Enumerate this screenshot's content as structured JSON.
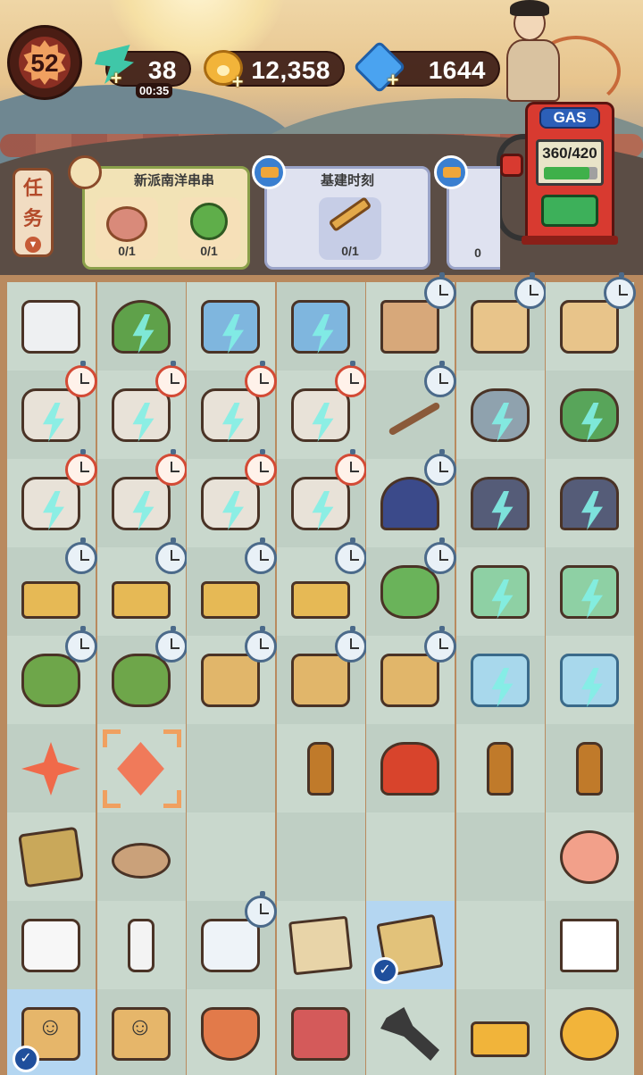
{
  "hud": {
    "level": "52",
    "energy": "38",
    "energy_timer": "00:35",
    "coins": "12,358",
    "gems": "1644",
    "plus": "+"
  },
  "gas_pump": {
    "label": "GAS",
    "amount": "360/420",
    "fill_fraction": 0.857
  },
  "tasks": {
    "tab_label_1": "任",
    "tab_label_2": "务",
    "cards": [
      {
        "title": "新派南洋串串",
        "slots": [
          {
            "icon": "meat-patty-icon",
            "count": "0/1"
          },
          {
            "icon": "broccoli-icon",
            "count": "0/1"
          }
        ]
      },
      {
        "title": "基建时刻",
        "slots": [
          {
            "icon": "hammer-icon",
            "count": "0/1"
          }
        ]
      },
      {
        "title": "",
        "slots": [
          {
            "icon": "partial-item-icon",
            "count": "0"
          }
        ]
      }
    ]
  },
  "board": {
    "rows": [
      [
        "printer",
        "tree-bolt",
        "book-bolt",
        "book-bolt",
        "shelf-timer",
        "cabinet-timer",
        "cabinet-timer"
      ],
      [
        "logs-bolt-redtimer",
        "logs-bolt-redtimer",
        "logs-bolt-redtimer",
        "logs-bolt-redtimer",
        "feather-timer",
        "drum-bolt",
        "drum-green-bolt"
      ],
      [
        "logs-bolt-redtimer",
        "logs-bolt-redtimer",
        "logs-bolt-redtimer",
        "logs-bolt-redtimer",
        "hat-timer",
        "chef-bolt",
        "chef-bolt"
      ],
      [
        "drone-timer",
        "drone-timer",
        "drone-timer",
        "drone-timer",
        "scooter-timer",
        "cart-bolt",
        "cart-bolt"
      ],
      [
        "bike-timer",
        "bike-timer",
        "dolly-timer",
        "dolly-timer",
        "dolly-timer",
        "cooler-bolt",
        "cooler-bolt"
      ],
      [
        "star-piece",
        "diamond-piece-selected",
        "empty",
        "sauce-bottle",
        "chili-jar",
        "sauce-bottle",
        "sauce-bottle"
      ],
      [
        "spice-mat",
        "pancake",
        "empty",
        "empty",
        "empty",
        "empty",
        "peach"
      ],
      [
        "spice-box",
        "ink-bottle",
        "ink-pot-timer",
        "rice-bag",
        "beans-bag-checked",
        "empty",
        "sugar-cubes"
      ],
      [
        "paper-bag-checked",
        "paper-bag",
        "shrimp-bowl",
        "gift-box",
        "pliers",
        "gold-bars",
        "paw-coins"
      ]
    ]
  }
}
